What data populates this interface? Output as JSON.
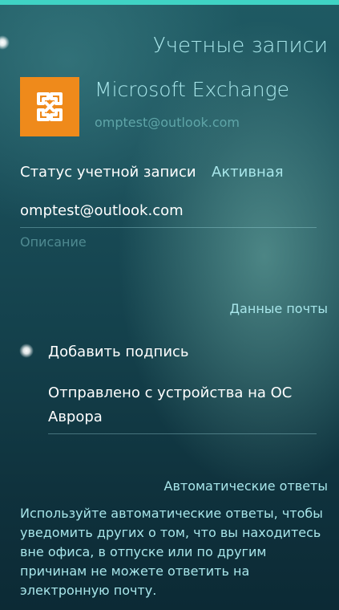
{
  "colors": {
    "accent": "#3fd3c4",
    "highlight_text": "#a8e6ea",
    "secondary_text": "#4f8a91",
    "logo_bg": "#ef8a1b"
  },
  "header": {
    "title": "Учетные записи"
  },
  "account": {
    "icon": "exchange-logo-icon",
    "name": "Microsoft Exchange",
    "email": "omptest@outlook.com"
  },
  "status": {
    "label": "Статус учетной записи",
    "value": "Активная"
  },
  "username_field": {
    "value": "omptest@outlook.com"
  },
  "description_field": {
    "placeholder": "Описание"
  },
  "mail_section": {
    "title": "Данные почты"
  },
  "signature": {
    "switch_label": "Добавить подпись",
    "switch_on": true,
    "text": "Отправлено с устройства на ОС Аврора"
  },
  "auto_replies": {
    "title": "Автоматические ответы",
    "description": "Используйте автоматические ответы, чтобы уведомить других о том, что вы находитесь вне офиса, в отпуске или по другим причинам не можете ответить на электронную почту."
  }
}
